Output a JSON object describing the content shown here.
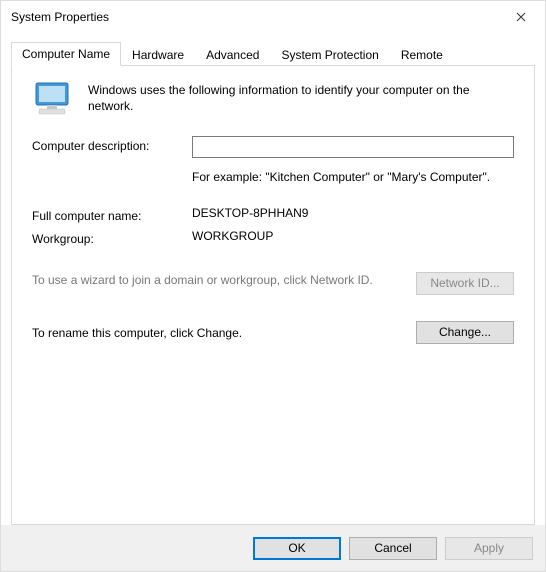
{
  "titlebar": {
    "title": "System Properties"
  },
  "tabs": {
    "computer_name": "Computer Name",
    "hardware": "Hardware",
    "advanced": "Advanced",
    "system_protection": "System Protection",
    "remote": "Remote"
  },
  "panel": {
    "intro": "Windows uses the following information to identify your computer on the network.",
    "labels": {
      "description": "Computer description:",
      "full_name": "Full computer name:",
      "workgroup": "Workgroup:"
    },
    "description_value": "",
    "example": "For example: \"Kitchen Computer\" or \"Mary's Computer\".",
    "full_name_value": "DESKTOP-8PHHAN9",
    "workgroup_value": "WORKGROUP",
    "wizard_domain_text": "To use a wizard to join a domain or workgroup, click Network ID.",
    "wizard_rename_text": "To rename this computer, click Change.",
    "buttons": {
      "network_id": "Network ID...",
      "change": "Change..."
    }
  },
  "footer": {
    "ok": "OK",
    "cancel": "Cancel",
    "apply": "Apply"
  }
}
